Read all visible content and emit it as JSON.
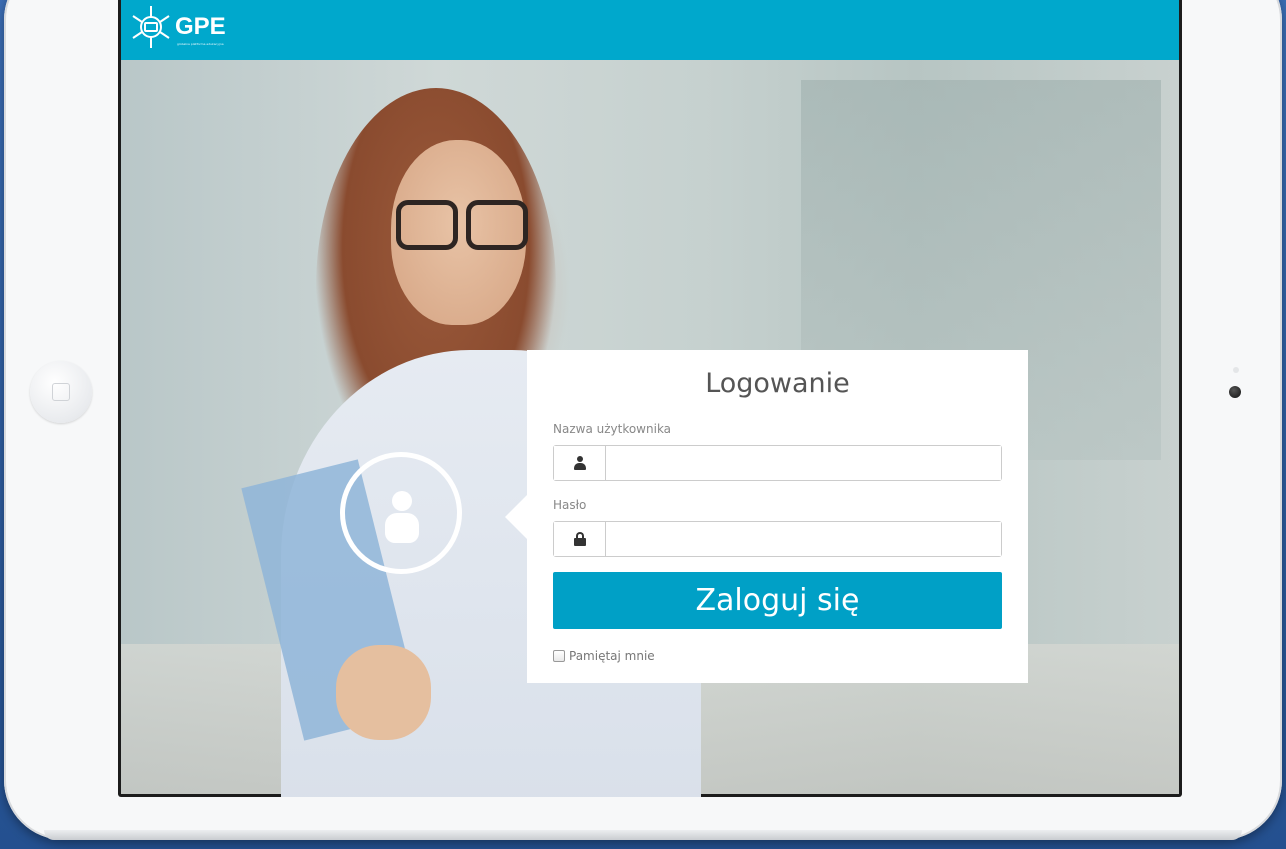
{
  "app": {
    "logo_text": "GPE",
    "logo_subtext": "globalna platforma edukacyjna"
  },
  "login": {
    "title": "Logowanie",
    "username_label": "Nazwa użytkownika",
    "username_value": "",
    "password_label": "Hasło",
    "password_value": "",
    "submit_label": "Zaloguj się",
    "remember_label": "Pamiętaj mnie",
    "remember_checked": false
  },
  "icons": {
    "logo": "gpe-logo-icon",
    "avatar": "user-avatar-icon",
    "username": "user-icon",
    "password": "lock-icon"
  },
  "colors": {
    "brand": "#00a8cc",
    "button": "#00a0c6",
    "card_bg": "#ffffff"
  }
}
